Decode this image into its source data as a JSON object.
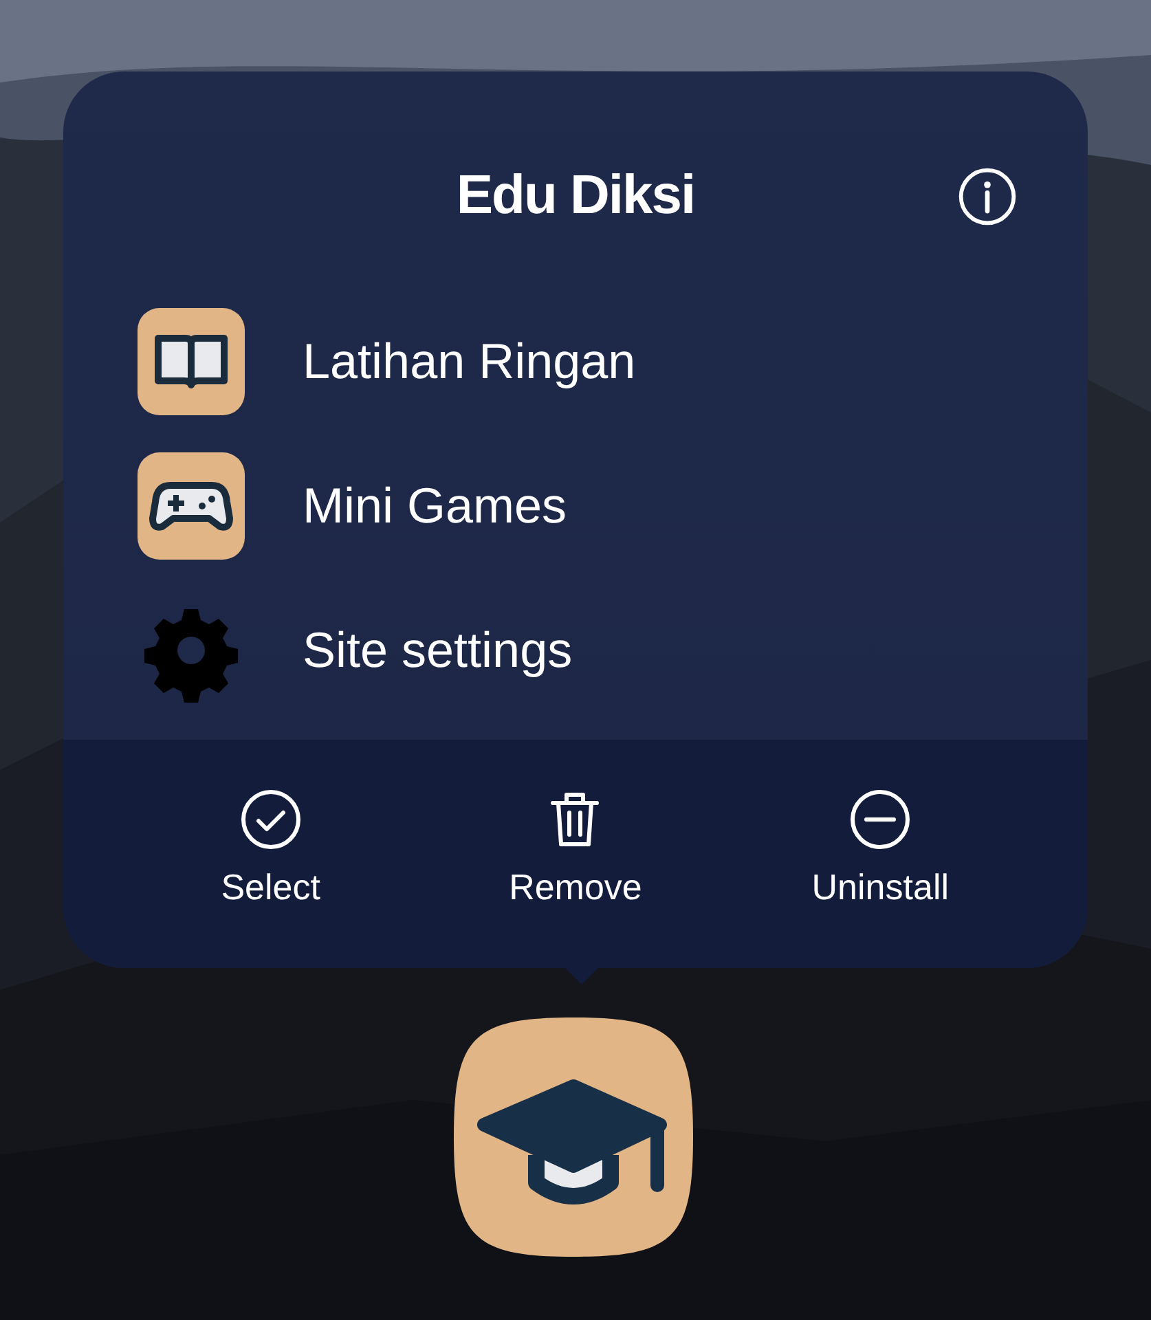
{
  "popup": {
    "title": "Edu Diksi",
    "shortcuts": [
      {
        "label": "Latihan Ringan",
        "kind": "book"
      },
      {
        "label": "Mini Games",
        "kind": "gamepad"
      },
      {
        "label": "Site settings",
        "kind": "gear"
      }
    ],
    "actions": [
      {
        "label": "Select",
        "kind": "check"
      },
      {
        "label": "Remove",
        "kind": "trash"
      },
      {
        "label": "Uninstall",
        "kind": "minus"
      }
    ]
  }
}
